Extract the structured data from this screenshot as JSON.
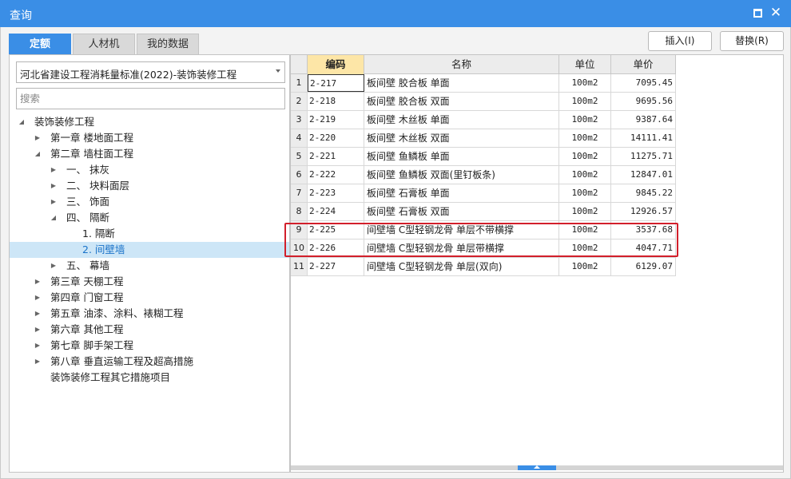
{
  "window": {
    "title": "查询"
  },
  "tabs": [
    "定额",
    "人材机",
    "我的数据"
  ],
  "buttons": {
    "insert": "插入(I)",
    "replace": "替换(R)"
  },
  "left": {
    "select_value": "河北省建设工程消耗量标准(2022)-装饰装修工程",
    "search_placeholder": "搜索"
  },
  "tree": [
    {
      "label": "装饰装修工程",
      "expanded": true
    },
    {
      "label": "第一章 楼地面工程",
      "expanded": false
    },
    {
      "label": "第二章 墙柱面工程",
      "expanded": true
    },
    {
      "label": "一、 抹灰",
      "expanded": false
    },
    {
      "label": "二、 块料面层",
      "expanded": false
    },
    {
      "label": "三、 饰面",
      "expanded": false
    },
    {
      "label": "四、 隔断",
      "expanded": true
    },
    {
      "label": "1. 隔断"
    },
    {
      "label": "2. 间壁墙",
      "selected": true
    },
    {
      "label": "五、 幕墙",
      "expanded": false
    },
    {
      "label": "第三章 天棚工程",
      "expanded": false
    },
    {
      "label": "第四章 门窗工程",
      "expanded": false
    },
    {
      "label": "第五章 油漆、涂料、裱糊工程",
      "expanded": false
    },
    {
      "label": "第六章 其他工程",
      "expanded": false
    },
    {
      "label": "第七章 脚手架工程",
      "expanded": false
    },
    {
      "label": "第八章 垂直运输工程及超高措施",
      "expanded": false
    },
    {
      "label": "装饰装修工程其它措施项目"
    }
  ],
  "table": {
    "columns": [
      "编码",
      "名称",
      "单位",
      "单价"
    ],
    "rows": [
      {
        "n": "1",
        "code": "2-217",
        "name": "板间壁 胶合板 单面",
        "unit": "100m2",
        "price": "7095.45"
      },
      {
        "n": "2",
        "code": "2-218",
        "name": "板间壁 胶合板 双面",
        "unit": "100m2",
        "price": "9695.56"
      },
      {
        "n": "3",
        "code": "2-219",
        "name": "板间壁 木丝板 单面",
        "unit": "100m2",
        "price": "9387.64"
      },
      {
        "n": "4",
        "code": "2-220",
        "name": "板间壁 木丝板 双面",
        "unit": "100m2",
        "price": "14111.41"
      },
      {
        "n": "5",
        "code": "2-221",
        "name": "板间壁 鱼鳞板 单面",
        "unit": "100m2",
        "price": "11275.71"
      },
      {
        "n": "6",
        "code": "2-222",
        "name": "板间壁 鱼鳞板 双面(里钉板条)",
        "unit": "100m2",
        "price": "12847.01"
      },
      {
        "n": "7",
        "code": "2-223",
        "name": "板间壁 石膏板 单面",
        "unit": "100m2",
        "price": "9845.22"
      },
      {
        "n": "8",
        "code": "2-224",
        "name": "板间壁 石膏板 双面",
        "unit": "100m2",
        "price": "12926.57"
      },
      {
        "n": "9",
        "code": "2-225",
        "name": "间壁墙 C型轻钢龙骨 单层不带横撑",
        "unit": "100m2",
        "price": "3537.68"
      },
      {
        "n": "10",
        "code": "2-226",
        "name": "间壁墙 C型轻钢龙骨 单层带横撑",
        "unit": "100m2",
        "price": "4047.71"
      },
      {
        "n": "11",
        "code": "2-227",
        "name": "间壁墙 C型轻钢龙骨 单层(双向)",
        "unit": "100m2",
        "price": "6129.07"
      }
    ]
  },
  "colors": {
    "accent": "#3a8ee6",
    "highlight": "#d21f2b",
    "selected_row": "#cde6f7",
    "code_header": "#fde6a7"
  }
}
